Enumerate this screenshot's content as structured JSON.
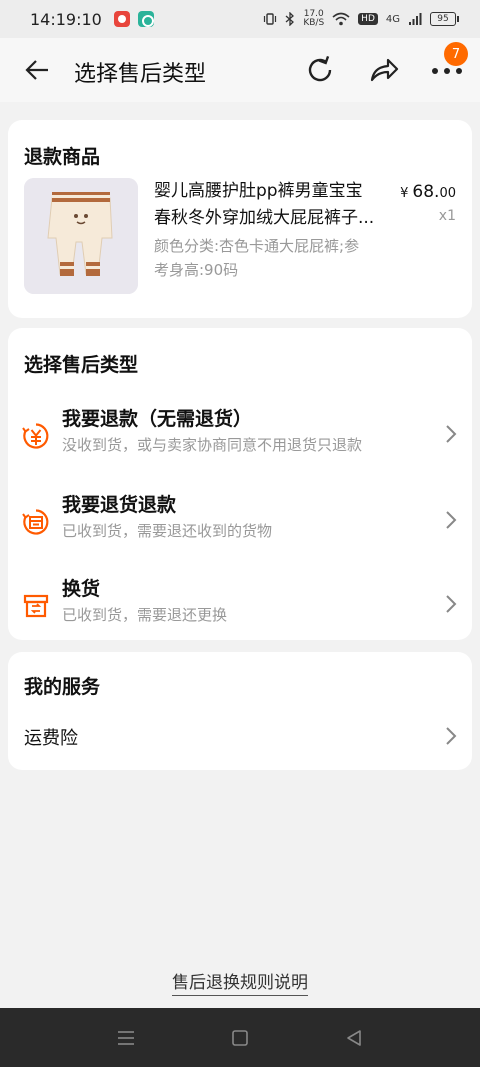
{
  "status_bar": {
    "time": "14:19:10",
    "net_speed_value": "17.0",
    "net_speed_unit": "KB/S",
    "hd_label": "HD",
    "signal_label": "4G",
    "battery": "95"
  },
  "nav": {
    "title": "选择售后类型",
    "more_badge": "7"
  },
  "refund_card": {
    "title": "退款商品",
    "product": {
      "name_line1": "婴儿高腰护肚pp裤男童宝宝",
      "name_line2": "春秋冬外穿加绒大屁屁裤子...",
      "spec_line1": "颜色分类:杏色卡通大屁屁裤;参",
      "spec_line2": "考身高:90码",
      "price_symbol": "¥",
      "price_main": "68.",
      "price_cents": "00",
      "quantity": "x1"
    }
  },
  "type_card": {
    "title": "选择售后类型",
    "options": [
      {
        "title": "我要退款（无需退货）",
        "subtitle": "没收到货，或与卖家协商同意不用退货只退款",
        "icon": "yen-refund-icon"
      },
      {
        "title": "我要退货退款",
        "subtitle": "已收到货，需要退还收到的货物",
        "icon": "return-box-icon"
      },
      {
        "title": "换货",
        "subtitle": "已收到货，需要退还更换",
        "icon": "exchange-box-icon"
      }
    ]
  },
  "service_card": {
    "title": "我的服务",
    "items": [
      {
        "label": "运费险"
      }
    ]
  },
  "footer": {
    "rules_link": "售后退换规则说明"
  },
  "colors": {
    "accent": "#ff6a00",
    "icon_orange": "#ff5a00",
    "background": "#f2f2f2",
    "system_nav": "#2a2a2a"
  }
}
